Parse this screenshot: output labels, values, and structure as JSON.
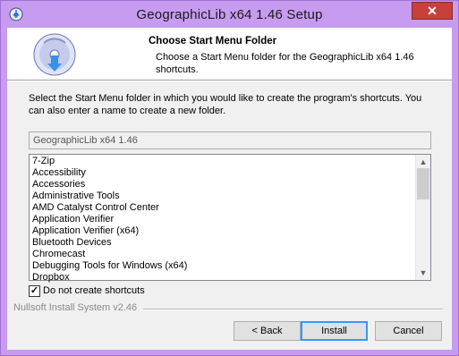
{
  "window": {
    "title": "GeographicLib x64 1.46 Setup",
    "close_glyph": "✕",
    "titlebar_color": "#c79bf0",
    "close_color": "#c7403a"
  },
  "header": {
    "title": "Choose Start Menu Folder",
    "subtitle": "Choose a Start Menu folder for the GeographicLib x64 1.46 shortcuts."
  },
  "intro_text": "Select the Start Menu folder in which you would like to create the program's shortcuts. You can also enter a name to create a new folder.",
  "folder_field": {
    "value": "GeographicLib x64 1.46",
    "disabled": true
  },
  "folder_list": {
    "items": [
      "7-Zip",
      "Accessibility",
      "Accessories",
      "Administrative Tools",
      "AMD Catalyst Control Center",
      "Application Verifier",
      "Application Verifier (x64)",
      "Bluetooth Devices",
      "Chromecast",
      "Debugging Tools for Windows (x64)",
      "Dropbox"
    ],
    "scroll_up_glyph": "▲",
    "scroll_down_glyph": "▼"
  },
  "no_shortcuts": {
    "label": "Do not create shortcuts",
    "checked": true,
    "check_glyph": "✓"
  },
  "branding": "Nullsoft Install System v2.46",
  "buttons": {
    "back": "< Back",
    "install": "Install",
    "cancel": "Cancel"
  },
  "icons": [
    "installer-app-icon",
    "installer-disc-logo",
    "close-icon",
    "scroll-up-arrow-icon",
    "scroll-down-arrow-icon",
    "checkmark-icon"
  ]
}
